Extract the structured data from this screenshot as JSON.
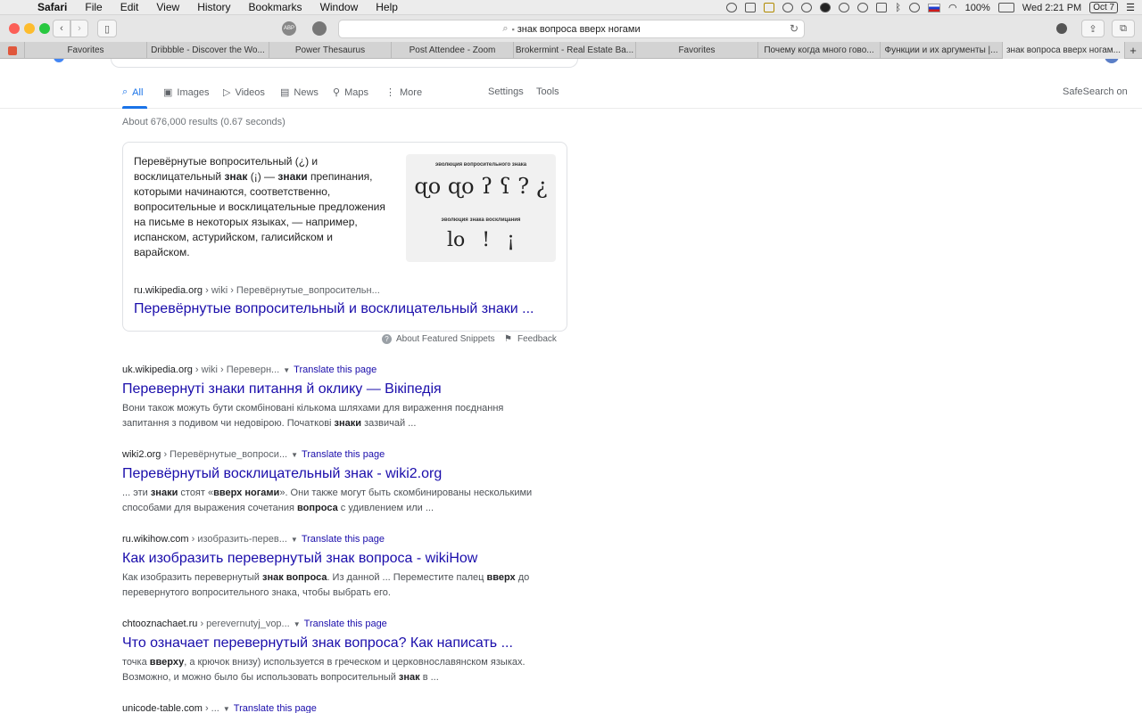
{
  "menubar": {
    "app": "Safari",
    "items": [
      "File",
      "Edit",
      "View",
      "History",
      "Bookmarks",
      "Window",
      "Help"
    ],
    "battery": "100%",
    "clock": "Wed 2:21 PM",
    "date": "Oct 7"
  },
  "toolbar": {
    "url": "знак вопроса вверх ногами"
  },
  "tabs": [
    "Favorites",
    "Dribbble - Discover the Wo...",
    "Power Thesaurus",
    "Post Attendee - Zoom",
    "Brokermint - Real Estate Ba...",
    "Favorites",
    "Почему когда много гово...",
    "Функции и их аргументы |...",
    "знак вопроса вверх ногам..."
  ],
  "nav": {
    "all": "All",
    "images": "Images",
    "videos": "Videos",
    "news": "News",
    "maps": "Maps",
    "more": "More",
    "settings": "Settings",
    "tools": "Tools",
    "safesearch": "SafeSearch on"
  },
  "stats": "About 676,000 results (0.67 seconds)",
  "snippet": {
    "text": [
      {
        "t": "Перевёрнутые вопросительный (¿) и восклицательный ",
        "b": false
      },
      {
        "t": "знак",
        "b": true
      },
      {
        "t": " (¡) — ",
        "b": false
      },
      {
        "t": "знаки",
        "b": true
      },
      {
        "t": " препинания, которыми начинаются, соответственно, вопросительные и восклицательные предложения на письме в некоторых языках, — например, испанском, астурийском, галисийском и варайском.",
        "b": false
      }
    ],
    "image_caption_1": "эволюция вопросительного знака",
    "image_glyphs_1": "ɋo ɋo ʔ ʕ ? ¿",
    "image_caption_2": "эволюция знака восклицания",
    "image_glyphs_2": "lo ! ¡",
    "cite": "ru.wikipedia.org",
    "cite_path": " › wiki › Перевёрнутые_вопросительн...",
    "title": "Перевёрнутые вопросительный и восклицательный знаки ...",
    "about": "About Featured Snippets",
    "feedback": "Feedback"
  },
  "results": [
    {
      "domain": "uk.wikipedia.org",
      "path": " › wiki › Переверн...",
      "translate": "Translate this page",
      "title": "Перевернуті знаки питання й оклику — Вікіпедія",
      "desc": [
        {
          "t": "Вони також можуть бути скомбіновані кількома шляхами для вираження поєднання запитання з подивом чи недовірою. Початкові ",
          "b": false
        },
        {
          "t": "знаки",
          "b": true
        },
        {
          "t": " зазвичай ...",
          "b": false
        }
      ]
    },
    {
      "domain": "wiki2.org",
      "path": " › Перевёрнутые_вопроси...",
      "translate": "Translate this page",
      "title": "Перевёрнутый восклицательный знак - wiki2.org",
      "desc": [
        {
          "t": "... эти ",
          "b": false
        },
        {
          "t": "знаки",
          "b": true
        },
        {
          "t": " стоят «",
          "b": false
        },
        {
          "t": "вверх ногами",
          "b": true
        },
        {
          "t": "». Они также могут быть скомбинированы несколькими способами для выражения сочетания ",
          "b": false
        },
        {
          "t": "вопроса",
          "b": true
        },
        {
          "t": " с удивлением или ...",
          "b": false
        }
      ]
    },
    {
      "domain": "ru.wikihow.com",
      "path": " › изобразить-перев...",
      "translate": "Translate this page",
      "title": "Как изобразить перевернутый знак вопроса - wikiHow",
      "desc": [
        {
          "t": "Как изобразить перевернутый ",
          "b": false
        },
        {
          "t": "знак вопроса",
          "b": true
        },
        {
          "t": ". Из данной ... Переместите палец ",
          "b": false
        },
        {
          "t": "вверх",
          "b": true
        },
        {
          "t": " до перевернутого вопросительного знака, чтобы выбрать его.",
          "b": false
        }
      ]
    },
    {
      "domain": "chtooznachaet.ru",
      "path": " › perevernutyj_vop...",
      "translate": "Translate this page",
      "title": "Что означает перевернутый знак вопроса? Как написать ...",
      "desc": [
        {
          "t": "точка ",
          "b": false
        },
        {
          "t": "вверху",
          "b": true
        },
        {
          "t": ", а крючок внизу) используется в греческом и церковнославянском языках. Возможно, и можно было бы использовать вопросительный ",
          "b": false
        },
        {
          "t": "знак",
          "b": true
        },
        {
          "t": " в ...",
          "b": false
        }
      ]
    },
    {
      "domain": "unicode-table.com",
      "path": " › ...",
      "translate": "Translate this page",
      "title": "",
      "desc": []
    }
  ]
}
